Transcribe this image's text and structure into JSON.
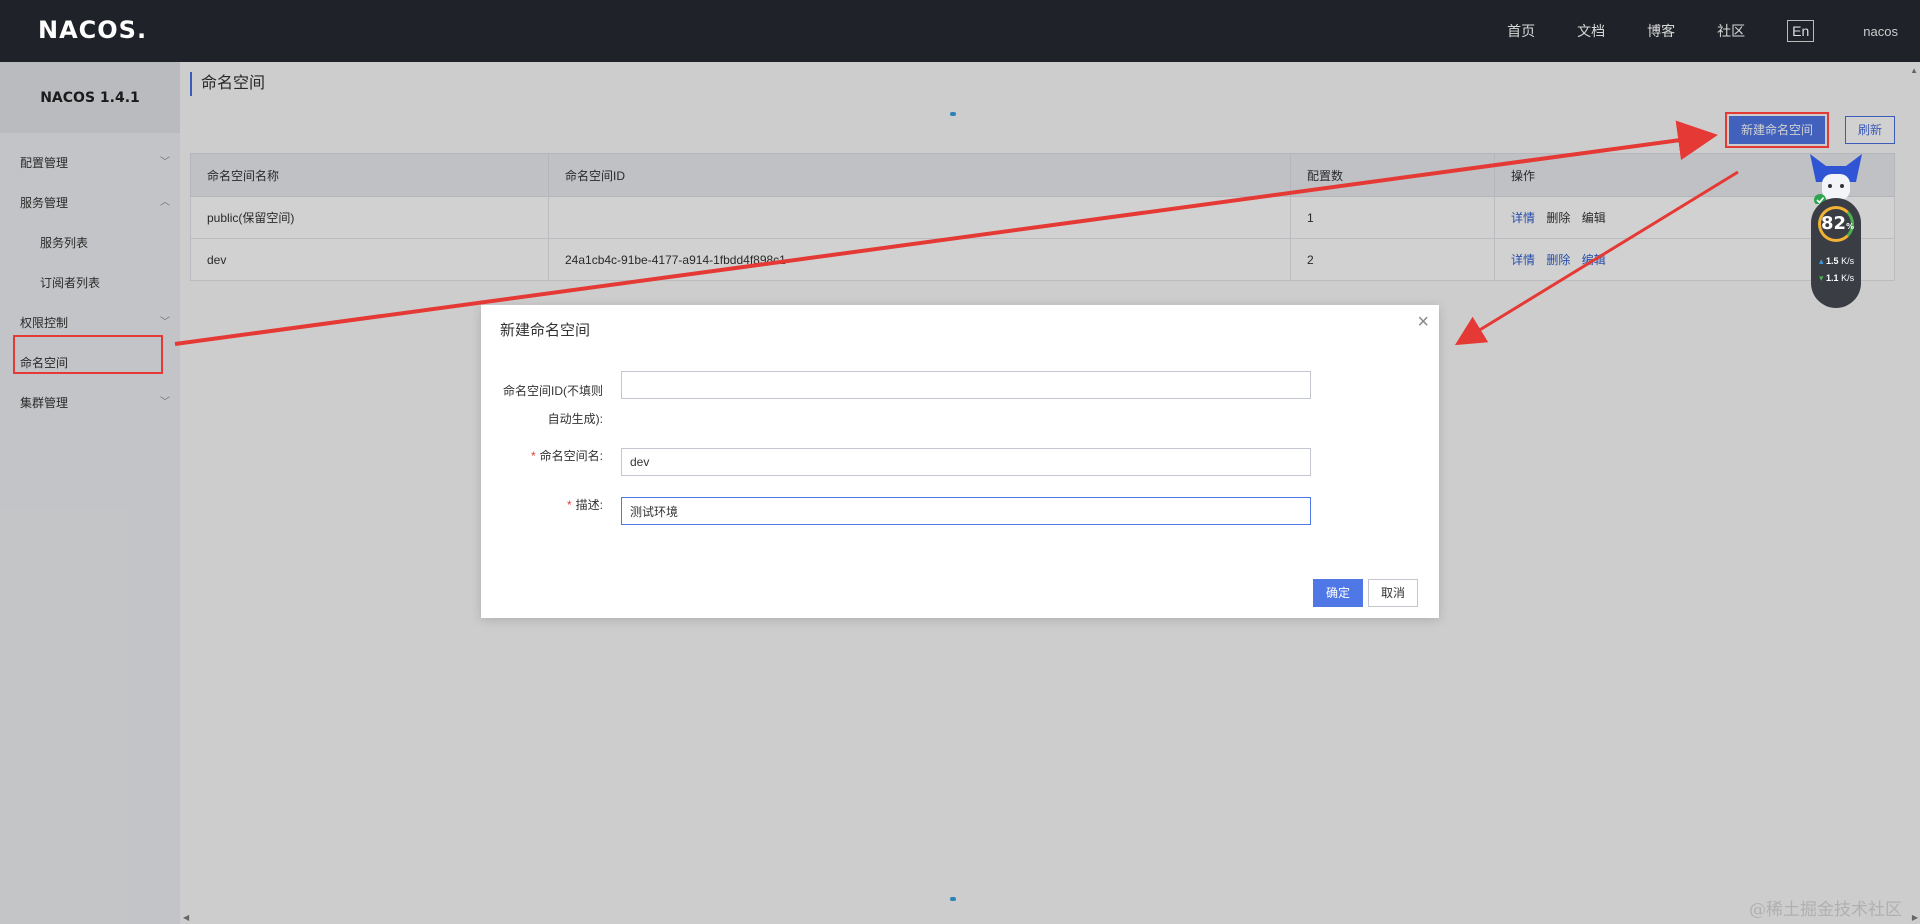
{
  "header": {
    "logo": "NACOS.",
    "nav": [
      "首页",
      "文档",
      "博客",
      "社区"
    ],
    "lang": "En",
    "user": "nacos"
  },
  "sidebar": {
    "version": "NACOS 1.4.1",
    "items": [
      {
        "label": "配置管理",
        "chevron": "﹀"
      },
      {
        "label": "服务管理",
        "chevron": "︿"
      },
      {
        "label": "服务列表",
        "chevron": ""
      },
      {
        "label": "订阅者列表",
        "chevron": ""
      },
      {
        "label": "权限控制",
        "chevron": "﹀"
      },
      {
        "label": "命名空间",
        "chevron": ""
      },
      {
        "label": "集群管理",
        "chevron": "﹀"
      }
    ]
  },
  "main": {
    "title": "命名空间",
    "new_button": "新建命名空间",
    "refresh_button": "刷新",
    "table": {
      "headers": [
        "命名空间名称",
        "命名空间ID",
        "配置数",
        "操作"
      ],
      "rows": [
        {
          "name": "public(保留空间)",
          "id": "",
          "count": "1",
          "ops": [
            "详情",
            "删除",
            "编辑"
          ]
        },
        {
          "name": "dev",
          "id": "24a1cb4c-91be-4177-a914-1fbdd4f898c1",
          "count": "2",
          "ops": [
            "详情",
            "删除",
            "编辑"
          ]
        }
      ]
    }
  },
  "dialog": {
    "title": "新建命名空间",
    "close": "×",
    "fields": [
      {
        "label_line1": "命名空间ID(不填则",
        "label_line2": "自动生成):",
        "required": false,
        "value": ""
      },
      {
        "label": "命名空间名:",
        "required": true,
        "value": "dev"
      },
      {
        "label": "描述:",
        "required": true,
        "value": "测试环境"
      }
    ],
    "ok": "确定",
    "cancel": "取消"
  },
  "widget": {
    "percent": "82",
    "percent_unit": "%",
    "up_speed": "1.5",
    "down_speed": "1.1",
    "speed_unit": "K/s"
  },
  "watermark": "@稀土掘金技术社区",
  "colors": {
    "accent": "#5077e6",
    "annotation": "#e53935",
    "header_bg": "#1f2329"
  }
}
